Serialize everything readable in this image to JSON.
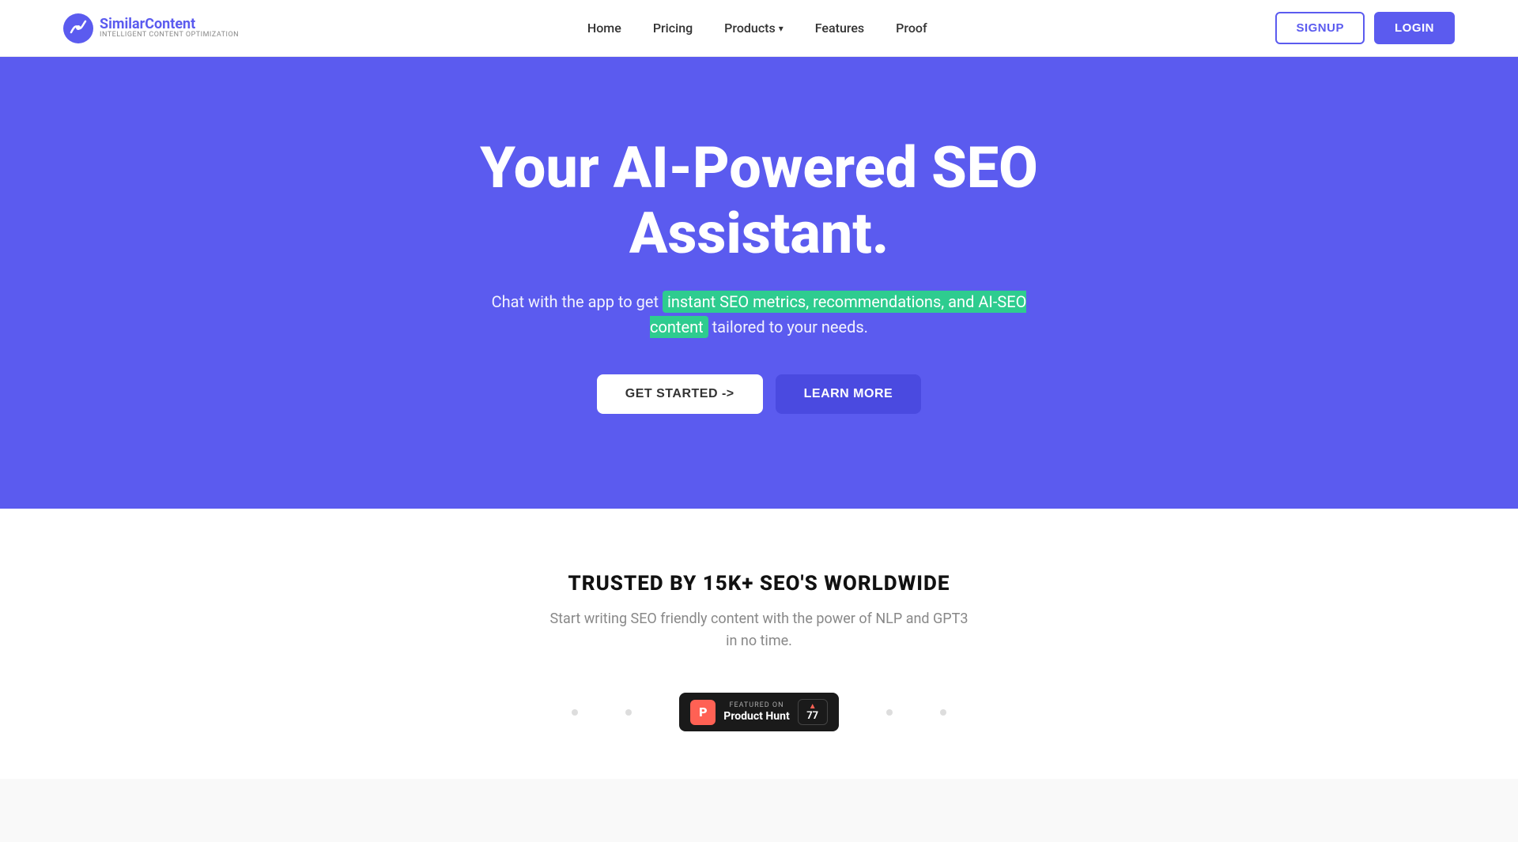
{
  "navbar": {
    "logo": {
      "name_part1": "Similar",
      "name_part2": "Content",
      "tagline": "INTELLIGENT CONTENT OPTIMIZATION"
    },
    "nav_items": [
      {
        "label": "Home",
        "id": "home"
      },
      {
        "label": "Pricing",
        "id": "pricing"
      },
      {
        "label": "Products",
        "id": "products",
        "has_dropdown": true
      },
      {
        "label": "Features",
        "id": "features"
      },
      {
        "label": "Proof",
        "id": "proof"
      }
    ],
    "signup_label": "SIGNUP",
    "login_label": "LOGIN"
  },
  "hero": {
    "title": "Your AI-Powered SEO Assistant.",
    "description_before": "Chat with the app to get ",
    "description_highlight": "instant SEO metrics, recommendations, and AI-SEO content",
    "description_after": " tailored to your needs.",
    "get_started_label": "GET STARTED ->",
    "learn_more_label": "LEARN MORE"
  },
  "trusted": {
    "title": "TRUSTED BY 15K+ SEO'S WORLDWIDE",
    "subtitle_line1": "Start writing SEO friendly content with the power of NLP and GPT3",
    "subtitle_line2": "in no time.",
    "product_hunt": {
      "featured_text": "FEATURED ON",
      "name": "Product Hunt",
      "votes": "77",
      "icon_letter": "P"
    }
  },
  "colors": {
    "primary": "#5b5bef",
    "accent_green": "#2ecc8f",
    "ph_red": "#ff6154",
    "dark": "#1a1a1a",
    "text_muted": "#888888",
    "white": "#ffffff"
  }
}
